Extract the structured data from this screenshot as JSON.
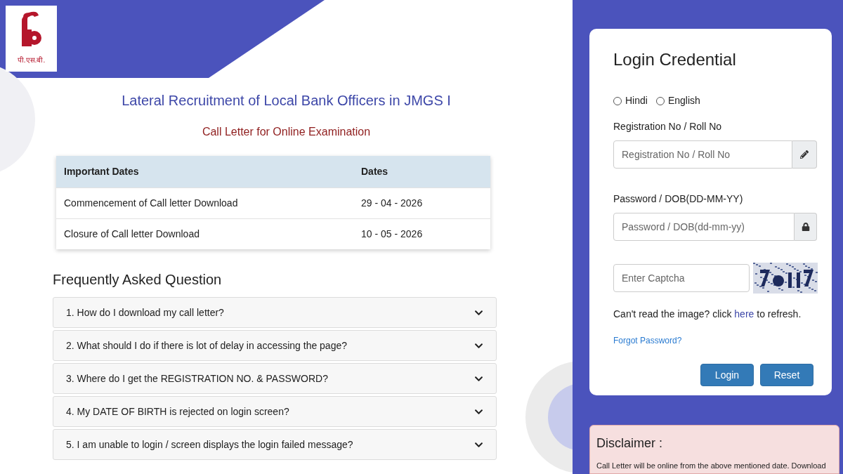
{
  "logo": {
    "caption": "पी.एस.बी."
  },
  "title": "Lateral Recruitment of Local Bank Officers in JMGS I",
  "subtitle": "Call Letter for Online Examination",
  "dates_table": {
    "columns": [
      "Important Dates",
      "Dates"
    ],
    "rows": [
      [
        "Commencement of Call letter Download",
        "29 - 04 - 2026"
      ],
      [
        "Closure of Call letter Download",
        "10 - 05 - 2026"
      ]
    ]
  },
  "faq": {
    "heading": "Frequently Asked Question",
    "items": [
      {
        "question": "1. How do I download my call letter?",
        "expanded": false
      },
      {
        "question": "2. What should I do if there is lot of delay in accessing the page?",
        "expanded": false
      },
      {
        "question": "3. Where do I get the REGISTRATION NO. & PASSWORD?",
        "expanded": false
      },
      {
        "question": "4. My DATE OF BIRTH is rejected on login screen?",
        "expanded": false
      },
      {
        "question": "5. I am unable to login / screen displays the login failed message?",
        "expanded": false
      }
    ]
  },
  "login": {
    "title": "Login Credential",
    "languages": [
      {
        "label": "Hindi",
        "selected": false
      },
      {
        "label": "English",
        "selected": false
      }
    ],
    "registration": {
      "label": "Registration No / Roll No",
      "placeholder": "Registration No / Roll No"
    },
    "password": {
      "label": "Password / DOB(DD-MM-YY)",
      "placeholder": "Password / DOB(dd-mm-yy)"
    },
    "captcha": {
      "placeholder": "Enter Captcha"
    },
    "refresh_note": {
      "before": "Can't read the image? click",
      "link": "here",
      "after": "to refresh."
    },
    "forgot_link": "Forgot Password?",
    "buttons": [
      "Login",
      "Reset"
    ]
  },
  "disclaimer": {
    "title": "Disclaimer :",
    "text": "Call Letter will be online from the above mentioned date. Download"
  }
}
